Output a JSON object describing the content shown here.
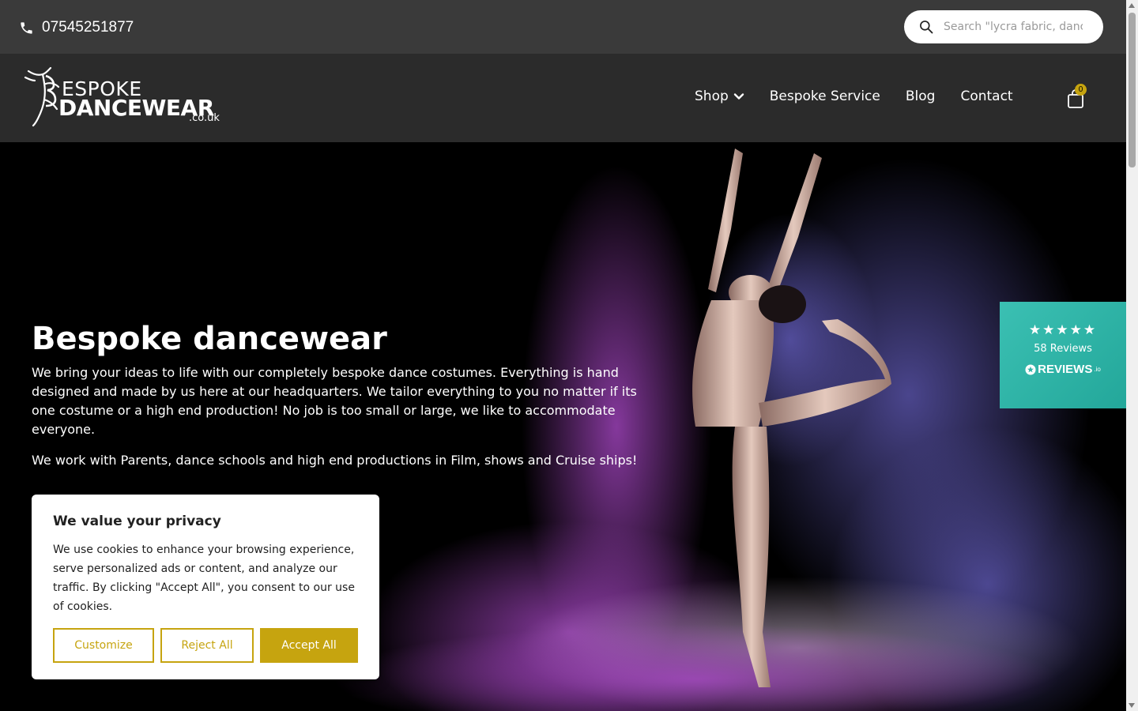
{
  "topbar": {
    "phone": "07545251877",
    "phone_icon": "phone-icon",
    "search_placeholder": "Search \"lycra fabric, dance",
    "search_icon": "search-icon"
  },
  "header": {
    "logo": {
      "line1": "ESPOKE",
      "line2": "DANCEWEAR",
      "line3": ".co.uk"
    },
    "nav": [
      {
        "label": "Shop"
      },
      {
        "label": "Bespoke Service"
      },
      {
        "label": "Blog"
      },
      {
        "label": "Contact"
      }
    ],
    "cart_count": "0",
    "cart_icon": "shopping-bag-icon"
  },
  "hero": {
    "title": "Bespoke dancewear",
    "paragraph1": "We bring your ideas to life with our completely bespoke dance costumes. Everything is hand designed and made by us here at our  headquarters. We tailor everything to you no matter if its one costume or a high end production! No job is too small or large, we like to accommodate everyone.",
    "paragraph2": "We work with Parents, dance schools and high end productions in Film, shows and Cruise ships!"
  },
  "reviews": {
    "stars": "★★★★★",
    "count_text": "58 Reviews",
    "brand": "REVIEWS",
    "brand_suffix": ".io"
  },
  "cookie": {
    "title": "We value your privacy",
    "body": "We use cookies to enhance your browsing experience, serve personalized ads or content, and analyze our traffic. By clicking \"Accept All\", you consent to our use of cookies.",
    "customize": "Customize",
    "reject": "Reject All",
    "accept": "Accept All"
  },
  "colors": {
    "accent": "#c6a40f",
    "topbar": "#3a3a3a",
    "header": "#2b2b2b",
    "reviews_bg": "#2fb3a6"
  }
}
